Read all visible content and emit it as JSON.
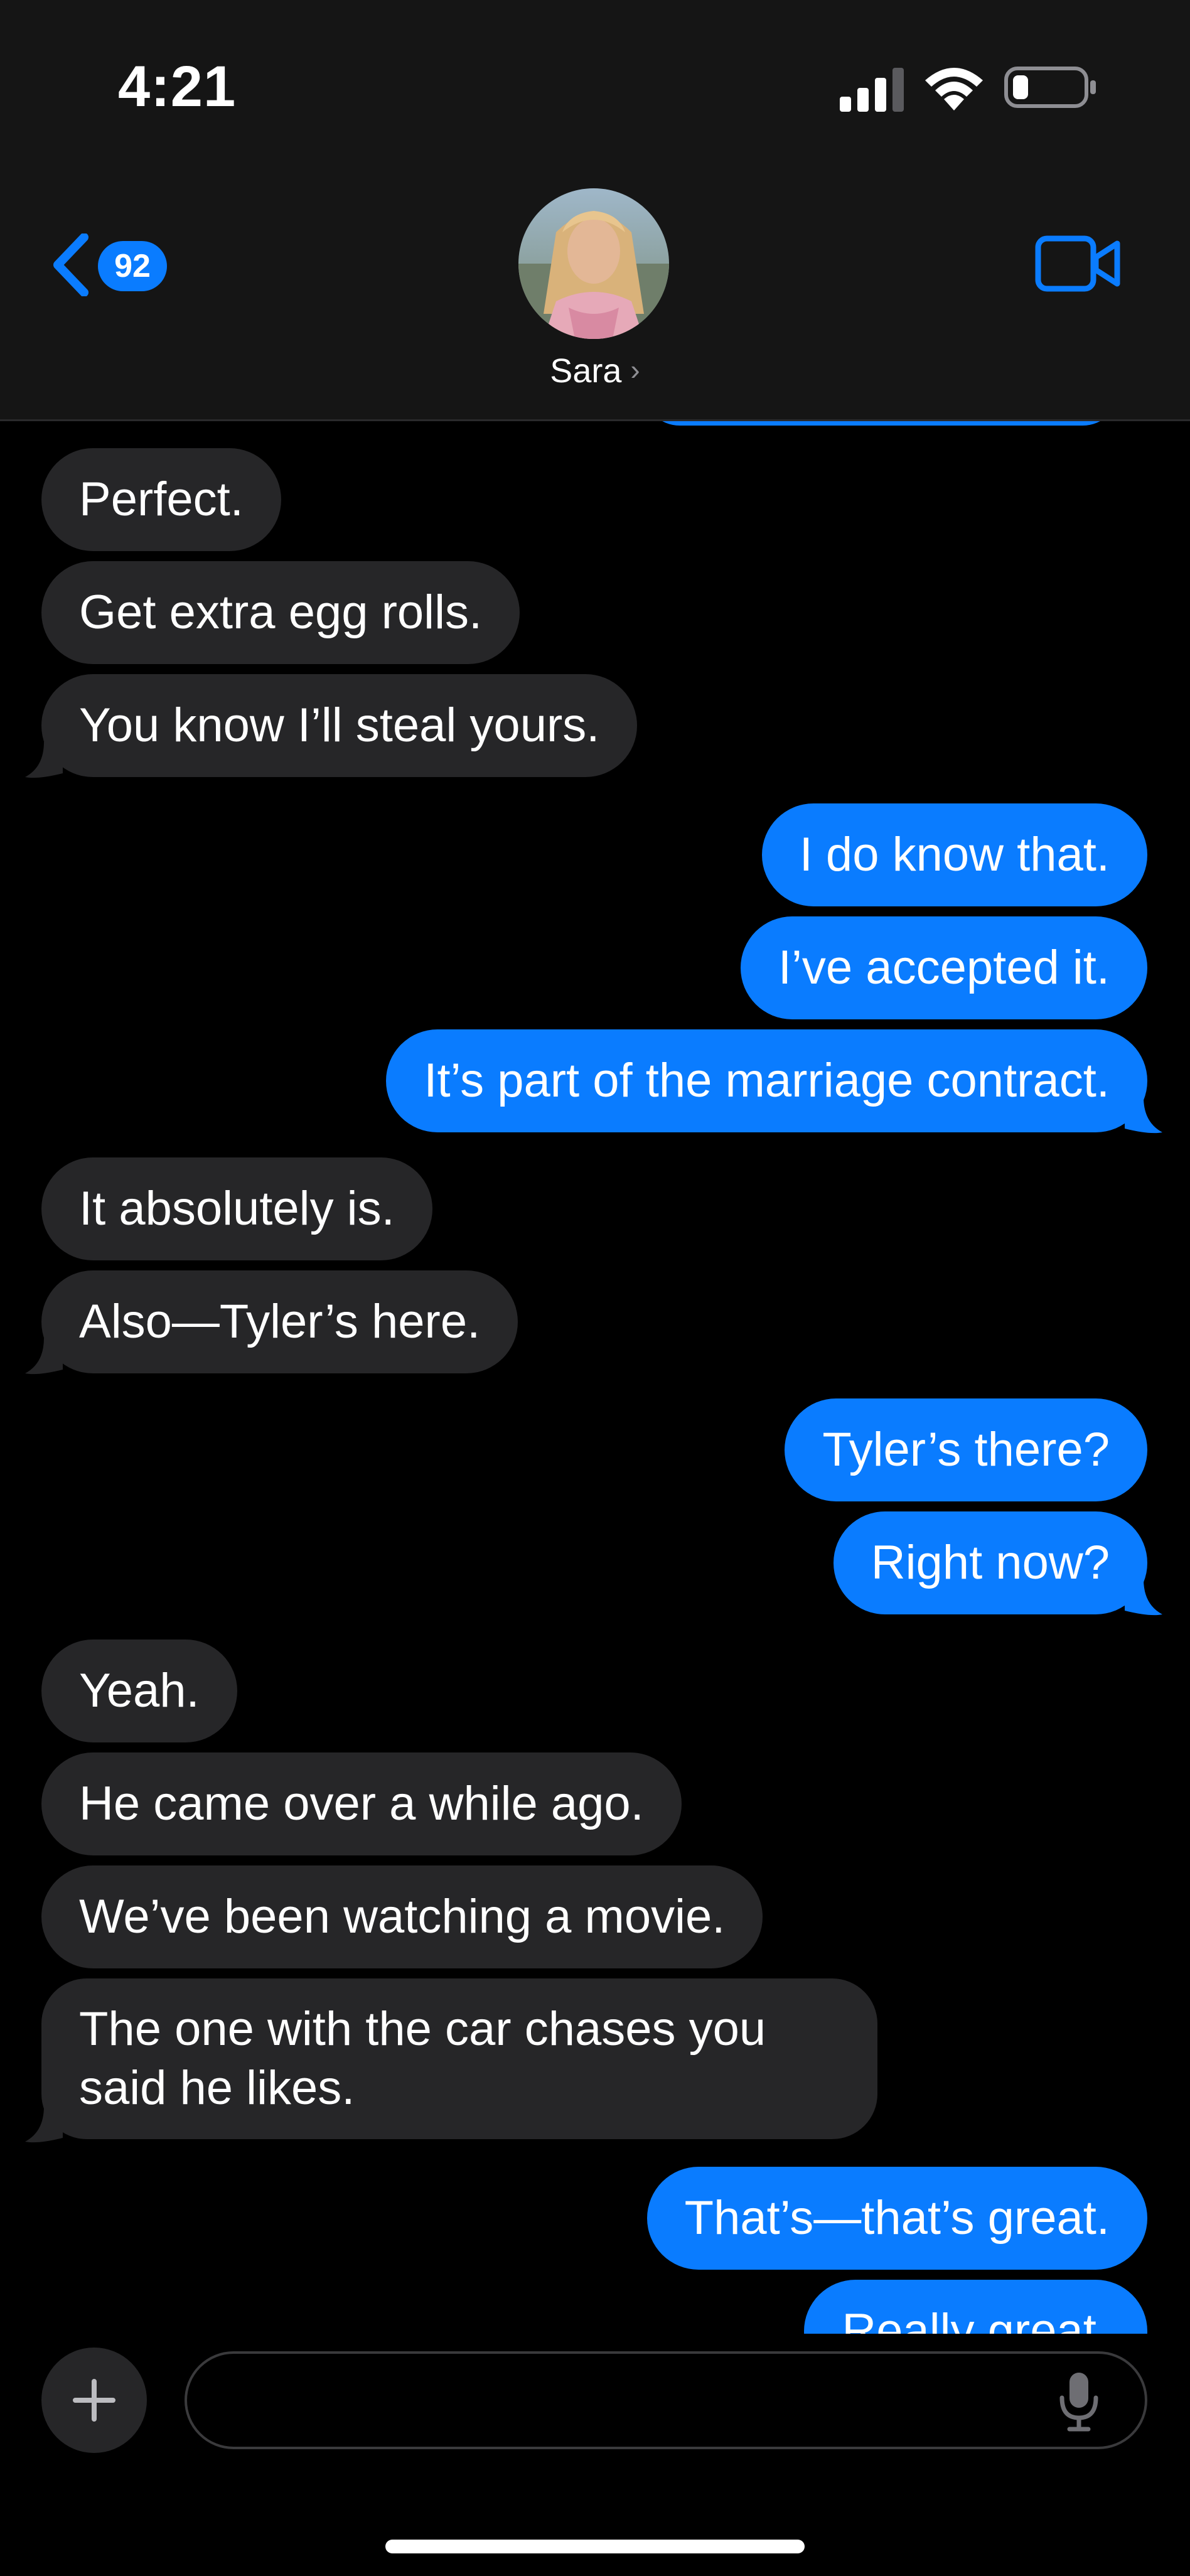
{
  "status_bar": {
    "time": "4:21",
    "icons": [
      "cellular-signal-icon",
      "wifi-icon",
      "battery-low-icon"
    ]
  },
  "header": {
    "back_badge": "92",
    "contact_name": "Sara",
    "name_chevron": "›",
    "icons": [
      "back-chevron-icon",
      "video-call-icon"
    ]
  },
  "colors": {
    "outgoing": "#0a7cff",
    "incoming": "#262628",
    "background": "#000000",
    "header": "#151515"
  },
  "messages": [
    {
      "side": "out",
      "text": ""
    },
    {
      "side": "in",
      "text": "Perfect."
    },
    {
      "side": "in",
      "text": "Get extra egg rolls."
    },
    {
      "side": "in",
      "text": "You know I’ll steal yours."
    },
    {
      "side": "out",
      "text": "I do know that."
    },
    {
      "side": "out",
      "text": "I’ve accepted it."
    },
    {
      "side": "out",
      "text": "It’s part of the marriage contract."
    },
    {
      "side": "in",
      "text": "It absolutely is."
    },
    {
      "side": "in",
      "text": "Also—Tyler’s here."
    },
    {
      "side": "out",
      "text": "Tyler’s there?"
    },
    {
      "side": "out",
      "text": "Right now?"
    },
    {
      "side": "in",
      "text": "Yeah."
    },
    {
      "side": "in",
      "text": "He came over a while ago."
    },
    {
      "side": "in",
      "text": "We’ve been watching a movie."
    },
    {
      "side": "in",
      "text": "The one with the car chases you said he likes."
    },
    {
      "side": "out",
      "text": "That’s—that’s great."
    },
    {
      "side": "out",
      "text": "Really great."
    }
  ],
  "composer": {
    "placeholder": "",
    "value": "",
    "icons": [
      "plus-icon",
      "microphone-icon"
    ]
  }
}
